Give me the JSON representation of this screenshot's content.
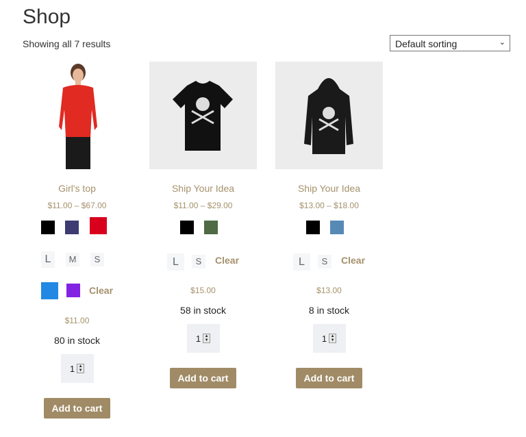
{
  "page": {
    "title": "Shop",
    "result_count": "Showing all 7 results",
    "sorting": "Default sorting"
  },
  "products": [
    {
      "name": "Girl's top",
      "price_range": "$11.00 – $67.00",
      "colors": [
        "#000000",
        "#3d3b72",
        "#d9001e"
      ],
      "sizes": [
        "L",
        "M",
        "S"
      ],
      "colors2": [
        "#2188e3",
        "#8223e3"
      ],
      "clear": "Clear",
      "price": "$11.00",
      "stock": "80 in stock",
      "qty": "1",
      "button": "Add to cart"
    },
    {
      "name": "Ship Your Idea",
      "price_range": "$11.00 – $29.00",
      "colors": [
        "#000000",
        "#4f6a45"
      ],
      "sizes": [
        "L",
        "S"
      ],
      "clear": "Clear",
      "price": "$15.00",
      "stock": "58 in stock",
      "qty": "1",
      "button": "Add to cart"
    },
    {
      "name": "Ship Your Idea",
      "price_range": "$13.00 – $18.00",
      "colors": [
        "#000000",
        "#5789b5"
      ],
      "sizes": [
        "L",
        "S"
      ],
      "clear": "Clear",
      "price": "$13.00",
      "stock": "8 in stock",
      "qty": "1",
      "button": "Add to cart"
    }
  ]
}
